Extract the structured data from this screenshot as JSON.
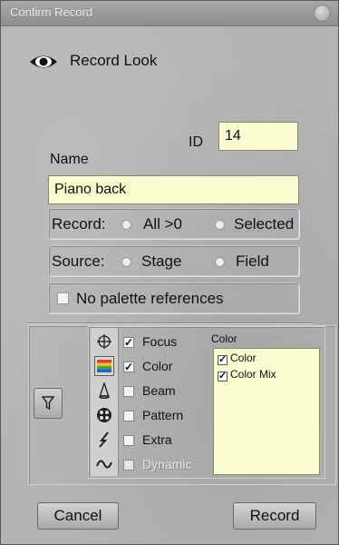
{
  "window": {
    "title": "Confirm Record"
  },
  "header": {
    "title": "Record Look",
    "icon": "eye-icon"
  },
  "id_field": {
    "label": "ID",
    "value": "14"
  },
  "name_field": {
    "label": "Name",
    "value": "Piano back"
  },
  "record_group": {
    "label": "Record:",
    "options": [
      "All >0",
      "Selected"
    ]
  },
  "source_group": {
    "label": "Source:",
    "options": [
      "Stage",
      "Field"
    ]
  },
  "palette_option": {
    "label": "No palette references",
    "checked": false
  },
  "filter": {
    "icon": "filter-funnel-icon"
  },
  "categories": [
    {
      "label": "Focus",
      "checked": true,
      "icon": "crosshair-icon"
    },
    {
      "label": "Color",
      "checked": true,
      "icon": "color-icon",
      "selected": true
    },
    {
      "label": "Beam",
      "checked": false,
      "icon": "beam-icon"
    },
    {
      "label": "Pattern",
      "checked": false,
      "icon": "gobo-pattern-icon"
    },
    {
      "label": "Extra",
      "checked": false,
      "icon": "lightning-icon"
    },
    {
      "label": "Dynamic",
      "checked": false,
      "icon": "wave-icon",
      "disabled": true
    }
  ],
  "subpanel": {
    "title": "Color",
    "items": [
      {
        "label": "Color",
        "checked": true
      },
      {
        "label": "Color Mix",
        "checked": true
      }
    ]
  },
  "buttons": {
    "cancel": "Cancel",
    "record": "Record"
  }
}
